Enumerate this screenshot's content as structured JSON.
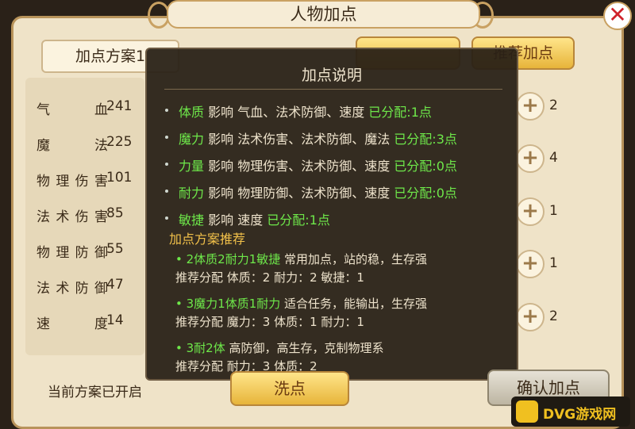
{
  "title": "人物加点",
  "close_glyph": "✕",
  "scheme_tab": "加点方案1",
  "top_buttons": [
    "推荐加点"
  ],
  "attributes": [
    {
      "name": "气血",
      "value": "241"
    },
    {
      "name": "魔法",
      "value": "225"
    },
    {
      "name": "物理伤害",
      "value": "101"
    },
    {
      "name": "法术伤害",
      "value": "85"
    },
    {
      "name": "物理防御",
      "value": "55"
    },
    {
      "name": "法术防御",
      "value": "47"
    },
    {
      "name": "速度",
      "value": "14"
    }
  ],
  "point_rows": [
    "2",
    "4",
    "1",
    "1",
    "2"
  ],
  "status": "当前方案已开启",
  "buttons": {
    "wash": "洗点",
    "confirm": "确认加点"
  },
  "overlay": {
    "title": "加点说明",
    "rows": [
      {
        "attr": "体质",
        "desc": "影响 气血、法术防御、速度",
        "alloc": "已分配:1点"
      },
      {
        "attr": "魔力",
        "desc": "影响 法术伤害、法术防御、魔法",
        "alloc": "已分配:3点"
      },
      {
        "attr": "力量",
        "desc": "影响 物理伤害、法术防御、速度",
        "alloc": "已分配:0点"
      },
      {
        "attr": "耐力",
        "desc": "影响 物理防御、法术防御、速度",
        "alloc": "已分配:0点"
      },
      {
        "attr": "敏捷",
        "desc": "影响 速度",
        "alloc": "已分配:1点"
      }
    ],
    "section": "加点方案推荐",
    "plans": [
      {
        "name": "2体质2耐力1敏捷",
        "desc": "常用加点，站的稳，生存强",
        "dist": "推荐分配 体质：2 耐力：2 敏捷：1"
      },
      {
        "name": "3魔力1体质1耐力",
        "desc": "适合任务，能输出，生存强",
        "dist": "推荐分配 魔力：3 体质：1 耐力：1"
      },
      {
        "name": "3耐2体",
        "desc": "高防御，高生存，克制物理系",
        "dist": "推荐分配 耐力：3 体质：2"
      }
    ]
  },
  "watermark": "DVG游戏网"
}
